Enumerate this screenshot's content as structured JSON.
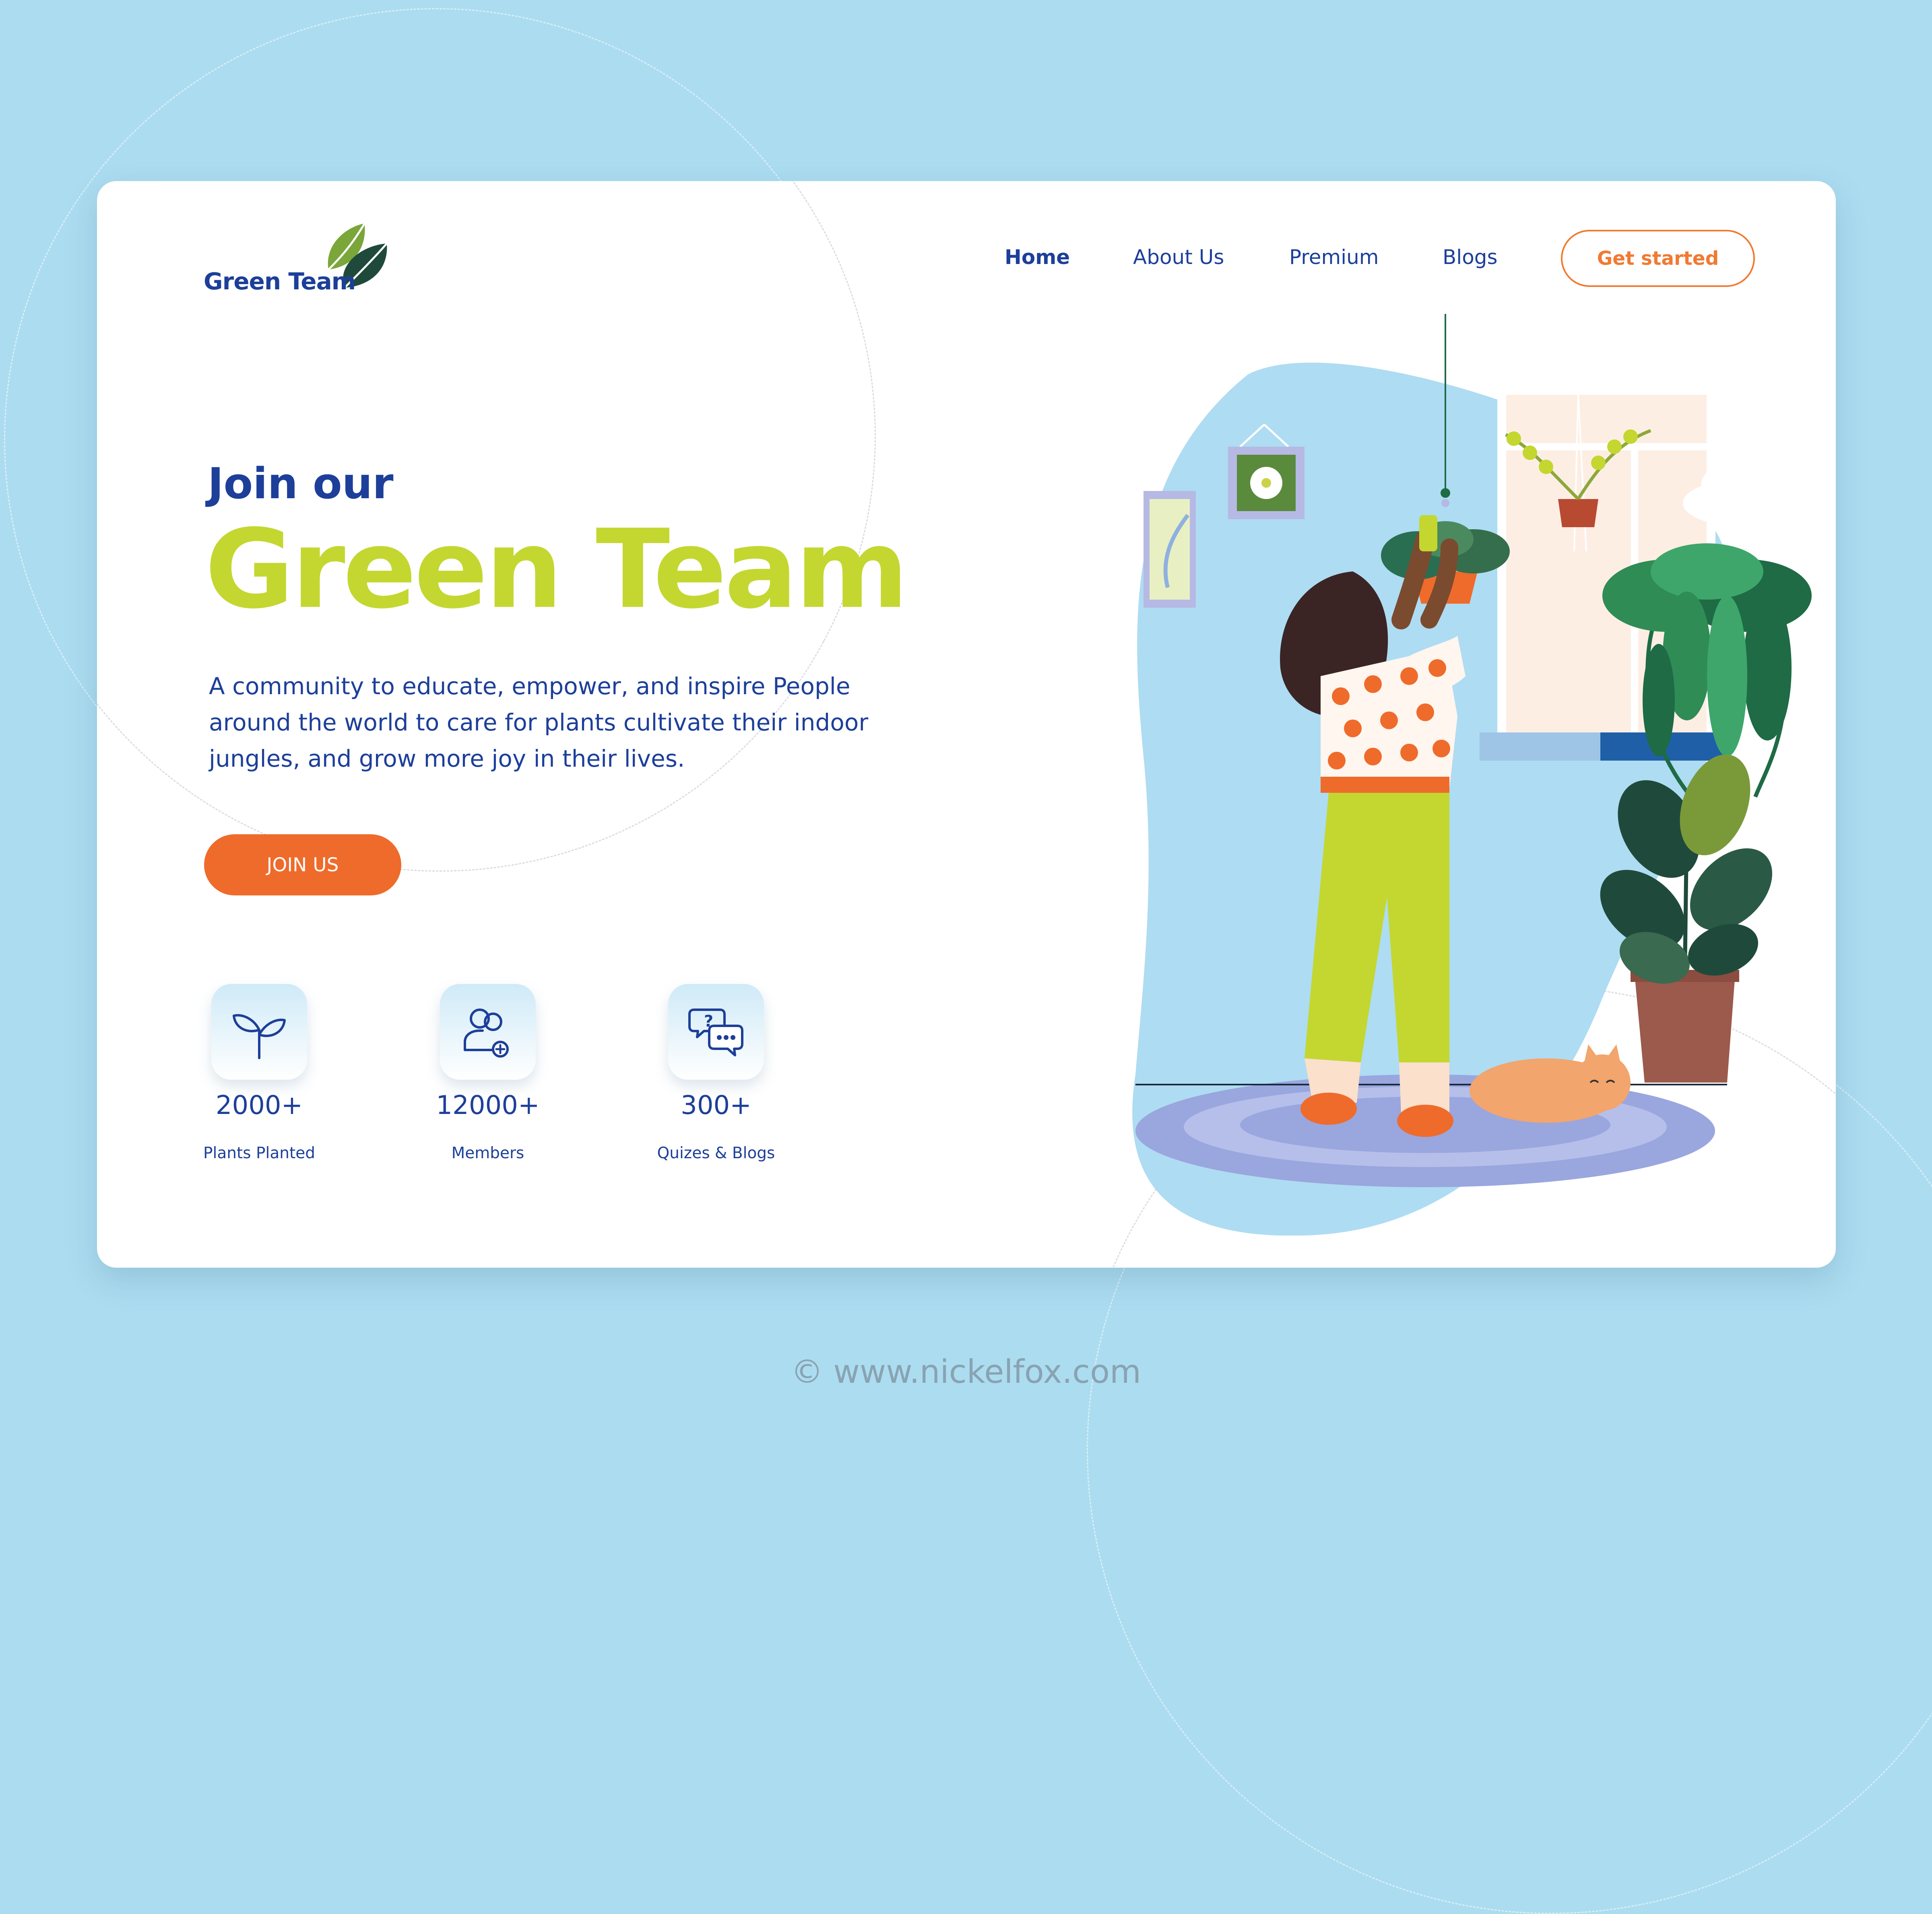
{
  "brand": {
    "name": "Green Team",
    "colors": {
      "background": "#acdcf0",
      "navy": "#1d3f9a",
      "lime": "#c3d730",
      "orange": "#ef6b2b",
      "sky": "#aedcf2"
    }
  },
  "nav": {
    "items": [
      {
        "label": "Home",
        "active": true
      },
      {
        "label": "About Us",
        "active": false
      },
      {
        "label": "Premium",
        "active": false
      },
      {
        "label": "Blogs",
        "active": false
      }
    ],
    "cta_label": "Get started"
  },
  "hero": {
    "kicker": "Join our",
    "title": "Green Team",
    "description": "A community to educate, empower, and inspire People around the world to care for plants cultivate their indoor jungles, and grow more joy in their lives.",
    "join_label": "JOIN US"
  },
  "stats": [
    {
      "icon": "sprout-icon",
      "value": "2000+",
      "label": "Plants Planted"
    },
    {
      "icon": "members-icon",
      "value": "12000+",
      "label": "Members"
    },
    {
      "icon": "chat-bubbles-icon",
      "value": "300+",
      "label": "Quizes & Blogs"
    }
  ],
  "footer": {
    "credit": "© www.nickelfox.com"
  }
}
